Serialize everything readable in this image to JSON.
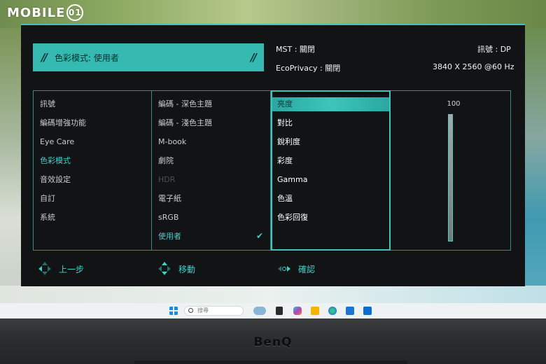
{
  "watermark": {
    "text": "MOBILE",
    "badge": "01"
  },
  "osd": {
    "mode_label": "色彩模式: 使用者",
    "mst": "MST : 關閉",
    "input": "訊號 : DP",
    "ecoprivacy": "EcoPrivacy : 關閉",
    "resolution": "3840 X 2560 @60 Hz",
    "main_menu": [
      "訊號",
      "編碼增強功能",
      "Eye Care",
      "色彩模式",
      "音效設定",
      "自訂",
      "系統"
    ],
    "main_menu_active": "色彩模式",
    "color_modes": [
      "編碼 - 深色主題",
      "編碼 - 淺色主題",
      "M-book",
      "劇院",
      "HDR",
      "電子紙",
      "sRGB",
      "使用者"
    ],
    "color_mode_disabled": "HDR",
    "color_mode_selected": "使用者",
    "adjust_items": [
      "亮度",
      "對比",
      "銳利度",
      "彩度",
      "Gamma",
      "色溫",
      "色彩回復"
    ],
    "adjust_highlight": "亮度",
    "slider": {
      "value": "100",
      "level": 1.0
    },
    "footer": {
      "back": "上一步",
      "move": "移動",
      "confirm": "確認"
    },
    "accent_color": "#3fc4bd"
  },
  "taskbar": {
    "search_placeholder": "搜尋",
    "icons": [
      "windows-start-icon",
      "search-icon",
      "weather-icon",
      "task-view-icon",
      "copilot-icon",
      "file-explorer-icon",
      "edge-icon",
      "store-icon",
      "outlook-icon"
    ]
  },
  "bezel": {
    "brand": "BenQ"
  }
}
